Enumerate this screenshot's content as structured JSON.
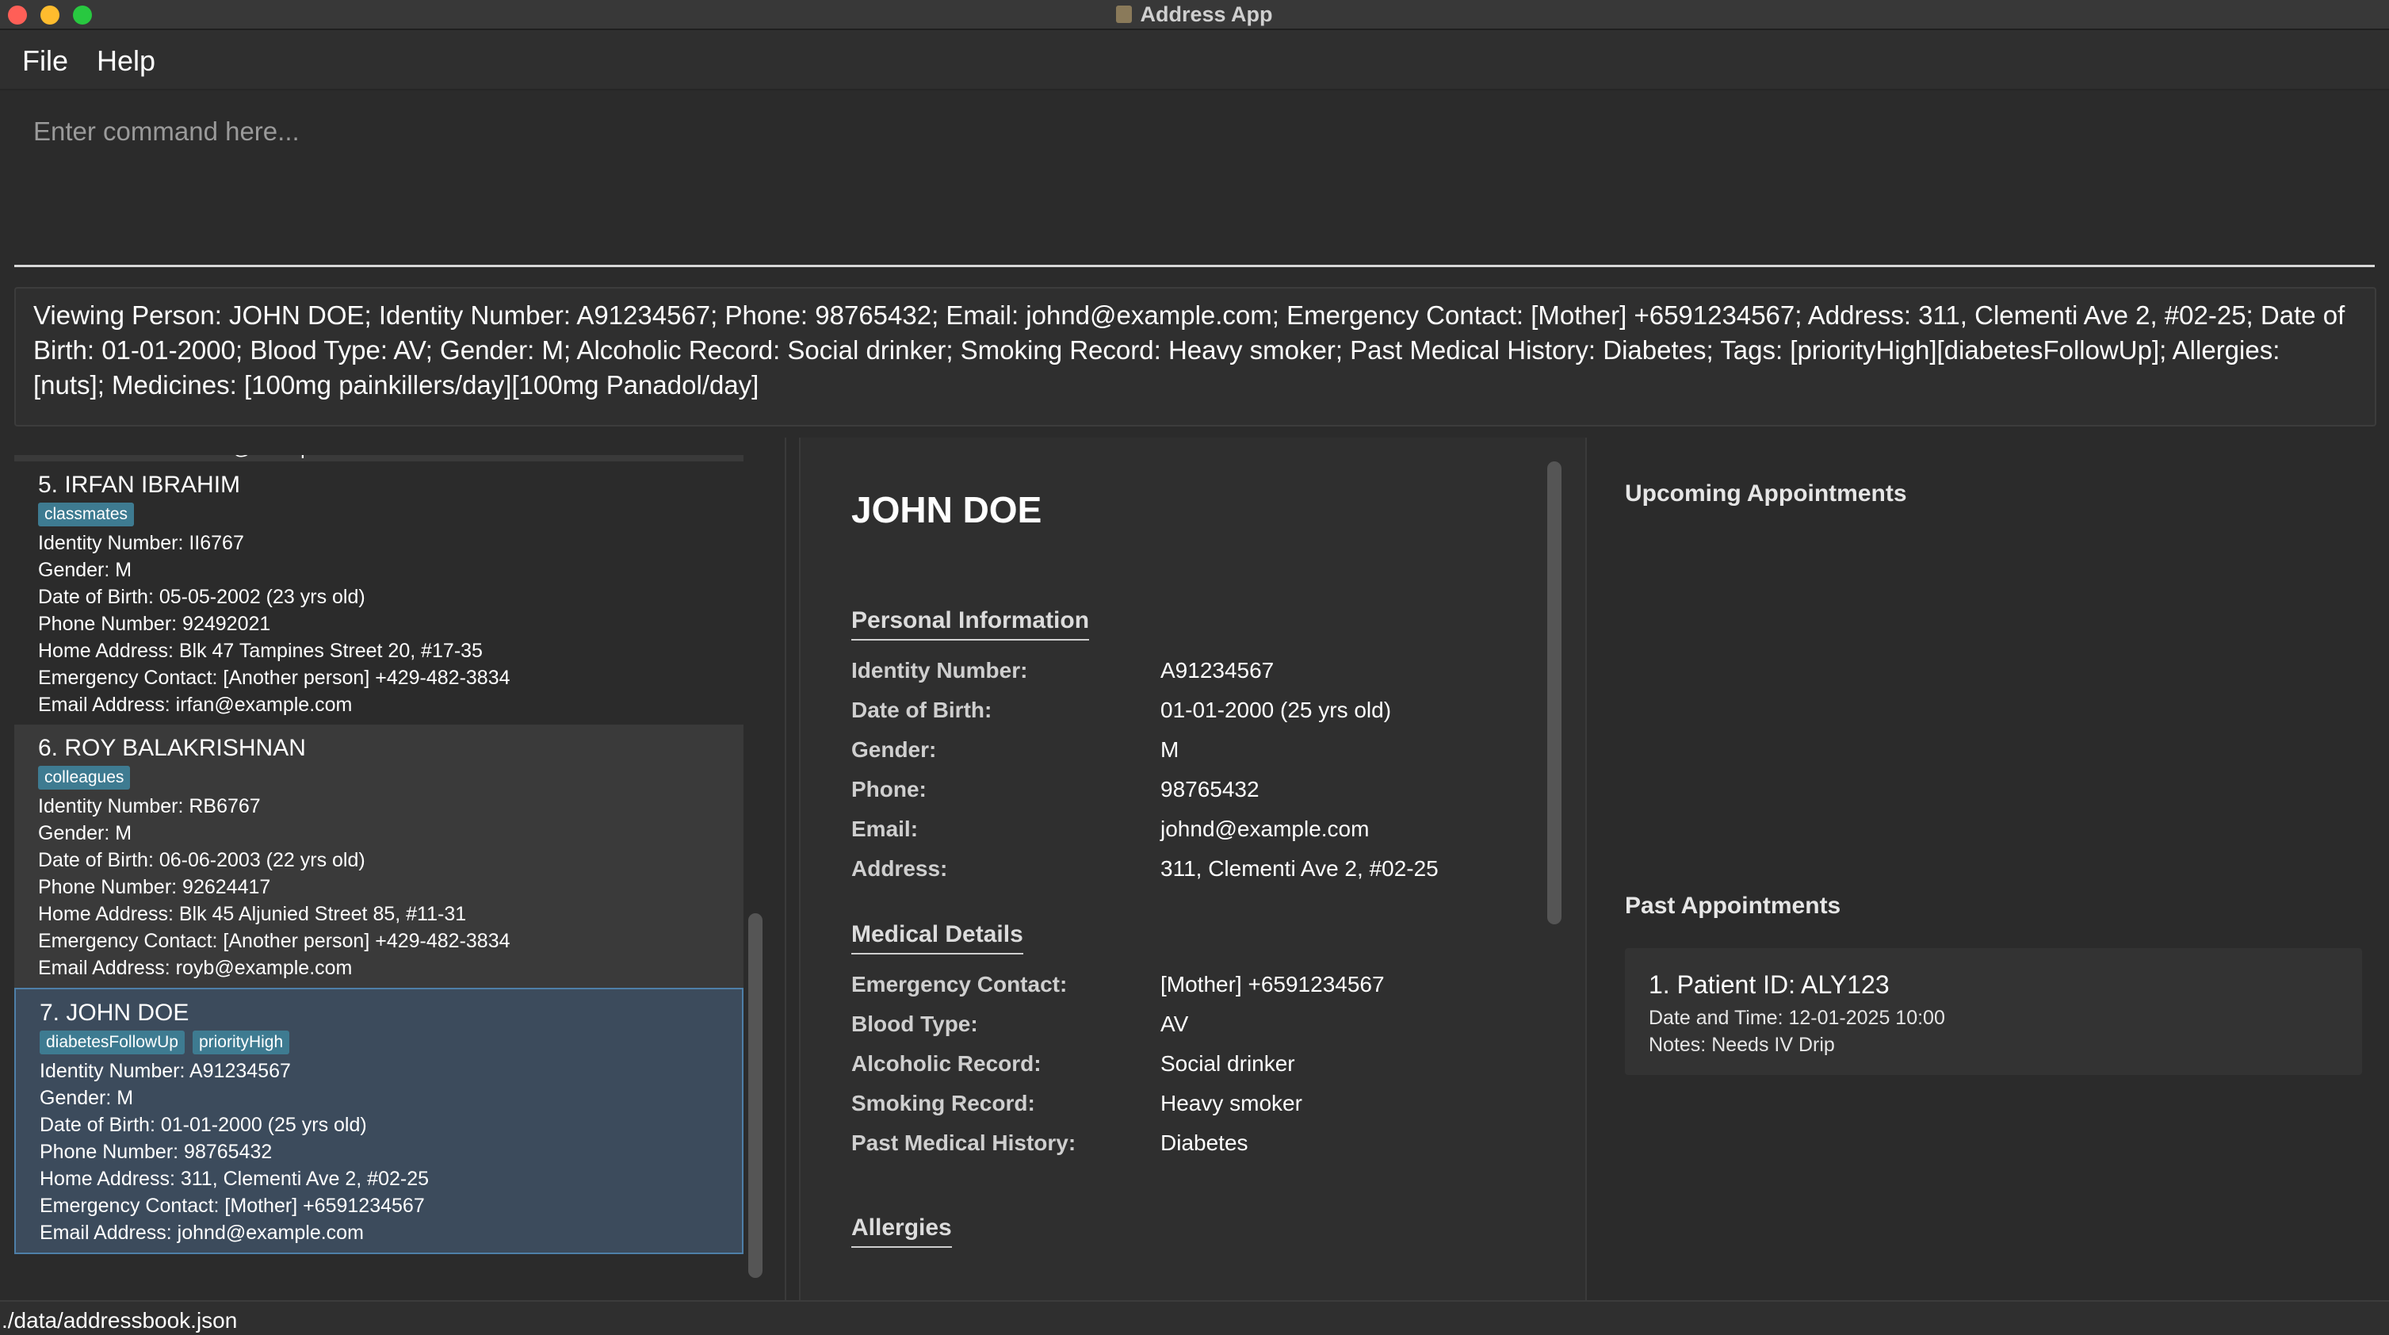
{
  "window": {
    "title": "Address App"
  },
  "menu": {
    "file": "File",
    "help": "Help"
  },
  "command": {
    "placeholder": "Enter command here...",
    "value": ""
  },
  "result": {
    "text": "Viewing Person: JOHN DOE; Identity Number: A91234567; Phone: 98765432; Email: johnd@example.com; Emergency Contact: [Mother] +6591234567; Address: 311, Clementi Ave 2, #02-25; Date of Birth: 01-01-2000; Blood Type: AV; Gender: M; Alcoholic Record: Social drinker; Smoking Record: Heavy smoker; Past Medical History: Diabetes; Tags: [priorityHigh][diabetesFollowUp]; Allergies: [nuts]; Medicines: [100mg painkillers/day][100mg Panadol/day]"
  },
  "list": {
    "partial_top": {
      "email": "Email Address: lidavid@example.com"
    },
    "persons": [
      {
        "name": "5. IRFAN IBRAHIM",
        "tags": [
          "classmates"
        ],
        "identity": "Identity Number: II6767",
        "gender": "Gender: M",
        "dob": "Date of Birth: 05-05-2002 (23 yrs old)",
        "phone": "Phone Number: 92492021",
        "address": "Home Address: Blk 47 Tampines Street 20, #17-35",
        "emergency": "Emergency Contact: [Another person] +429-482-3834",
        "email": "Email Address: irfan@example.com"
      },
      {
        "name": "6. ROY BALAKRISHNAN",
        "tags": [
          "colleagues"
        ],
        "identity": "Identity Number: RB6767",
        "gender": "Gender: M",
        "dob": "Date of Birth: 06-06-2003 (22 yrs old)",
        "phone": "Phone Number: 92624417",
        "address": "Home Address: Blk 45 Aljunied Street 85, #11-31",
        "emergency": "Emergency Contact: [Another person] +429-482-3834",
        "email": "Email Address: royb@example.com"
      },
      {
        "name": "7. JOHN DOE",
        "tags": [
          "diabetesFollowUp",
          "priorityHigh"
        ],
        "identity": "Identity Number: A91234567",
        "gender": "Gender: M",
        "dob": "Date of Birth: 01-01-2000 (25 yrs old)",
        "phone": "Phone Number: 98765432",
        "address": "Home Address: 311, Clementi Ave 2, #02-25",
        "emergency": "Emergency Contact: [Mother] +6591234567",
        "email": "Email Address: johnd@example.com"
      }
    ]
  },
  "detail": {
    "name": "JOHN DOE",
    "personal_heading": "Personal Information",
    "personal": [
      {
        "label": "Identity Number:",
        "value": "A91234567"
      },
      {
        "label": "Date of Birth:",
        "value": "01-01-2000 (25 yrs old)"
      },
      {
        "label": "Gender:",
        "value": "M"
      },
      {
        "label": "Phone:",
        "value": "98765432"
      },
      {
        "label": "Email:",
        "value": "johnd@example.com"
      },
      {
        "label": "Address:",
        "value": "311, Clementi Ave 2, #02-25"
      }
    ],
    "medical_heading": "Medical Details",
    "medical": [
      {
        "label": "Emergency Contact:",
        "value": "[Mother] +6591234567"
      },
      {
        "label": "Blood Type:",
        "value": "AV"
      },
      {
        "label": "Alcoholic Record:",
        "value": "Social drinker"
      },
      {
        "label": "Smoking Record:",
        "value": "Heavy smoker"
      },
      {
        "label": "Past Medical History:",
        "value": "Diabetes"
      }
    ],
    "allergies_heading": "Allergies"
  },
  "appointments": {
    "upcoming_heading": "Upcoming Appointments",
    "past_heading": "Past Appointments",
    "past": [
      {
        "title": "1.  Patient ID: ALY123",
        "datetime": "Date and Time: 12-01-2025 10:00",
        "notes": "Notes: Needs IV Drip"
      }
    ]
  },
  "status": {
    "path": "./data/addressbook.json"
  }
}
